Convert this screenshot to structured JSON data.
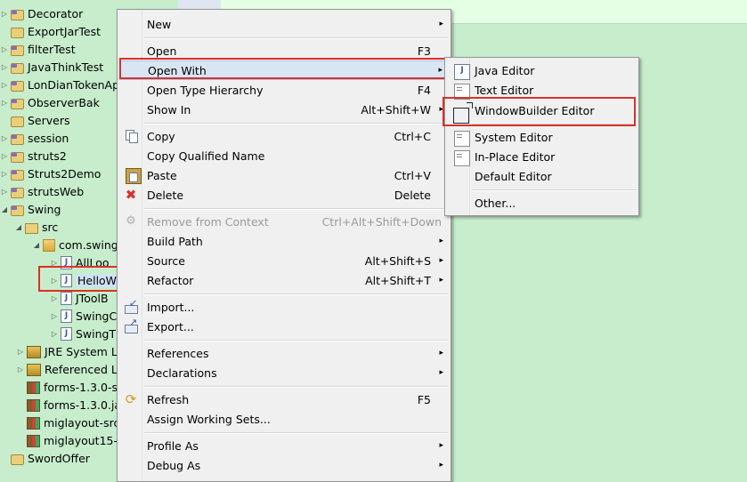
{
  "tree": {
    "items": [
      {
        "label": "Decorator",
        "type": "project"
      },
      {
        "label": "ExportJarTest",
        "type": "folder"
      },
      {
        "label": "filterTest",
        "type": "project"
      },
      {
        "label": "JavaThinkTest",
        "type": "project"
      },
      {
        "label": "LonDianTokenAp",
        "type": "project"
      },
      {
        "label": "ObserverBak",
        "type": "project"
      },
      {
        "label": "Servers",
        "type": "folder"
      },
      {
        "label": "session",
        "type": "project"
      },
      {
        "label": "struts2",
        "type": "project"
      },
      {
        "label": "Struts2Demo",
        "type": "project"
      },
      {
        "label": "strutsWeb",
        "type": "project"
      },
      {
        "label": "Swing",
        "type": "project"
      },
      {
        "label": "src",
        "type": "srcfolder"
      },
      {
        "label": "com.swing",
        "type": "package"
      },
      {
        "label": "AllLoo",
        "type": "java"
      },
      {
        "label": "HelloW",
        "type": "java"
      },
      {
        "label": "JToolB",
        "type": "java"
      },
      {
        "label": "SwingC",
        "type": "java"
      },
      {
        "label": "SwingT",
        "type": "java"
      },
      {
        "label": "JRE System Li",
        "type": "library"
      },
      {
        "label": "Referenced L",
        "type": "library"
      },
      {
        "label": "forms-1.3.0-s",
        "type": "jar"
      },
      {
        "label": "forms-1.3.0.ja",
        "type": "jar"
      },
      {
        "label": "miglayout-src",
        "type": "jar"
      },
      {
        "label": "miglayout15-",
        "type": "jar"
      },
      {
        "label": "SwordOffer",
        "type": "folder"
      }
    ]
  },
  "context_menu": {
    "items": [
      {
        "label": "New",
        "shortcut": "",
        "submenu": true
      },
      {
        "label": "Open",
        "shortcut": "F3"
      },
      {
        "label": "Open With",
        "shortcut": "",
        "submenu": true
      },
      {
        "label": "Open Type Hierarchy",
        "shortcut": "F4"
      },
      {
        "label": "Show In",
        "shortcut": "Alt+Shift+W",
        "submenu": true
      },
      {
        "label": "Copy",
        "shortcut": "Ctrl+C",
        "icon": "copy-icon"
      },
      {
        "label": "Copy Qualified Name",
        "shortcut": ""
      },
      {
        "label": "Paste",
        "shortcut": "Ctrl+V",
        "icon": "paste-icon"
      },
      {
        "label": "Delete",
        "shortcut": "Delete",
        "icon": "delete-icon"
      },
      {
        "label": "Remove from Context",
        "shortcut": "Ctrl+Alt+Shift+Down",
        "icon": "remove-context-icon",
        "disabled": true
      },
      {
        "label": "Build Path",
        "shortcut": "",
        "submenu": true
      },
      {
        "label": "Source",
        "shortcut": "Alt+Shift+S",
        "submenu": true
      },
      {
        "label": "Refactor",
        "shortcut": "Alt+Shift+T",
        "submenu": true
      },
      {
        "label": "Import...",
        "shortcut": "",
        "icon": "import-icon"
      },
      {
        "label": "Export...",
        "shortcut": "",
        "icon": "export-icon"
      },
      {
        "label": "References",
        "shortcut": "",
        "submenu": true
      },
      {
        "label": "Declarations",
        "shortcut": "",
        "submenu": true
      },
      {
        "label": "Refresh",
        "shortcut": "F5",
        "icon": "refresh-icon"
      },
      {
        "label": "Assign Working Sets...",
        "shortcut": ""
      },
      {
        "label": "Profile As",
        "shortcut": "",
        "submenu": true
      },
      {
        "label": "Debug As",
        "shortcut": "",
        "submenu": true
      }
    ],
    "submenu_arrow": "▸"
  },
  "open_with_submenu": {
    "items": [
      {
        "label": "Java Editor",
        "icon": "java-editor-icon"
      },
      {
        "label": "Text Editor",
        "icon": "text-editor-icon"
      },
      {
        "label": "WindowBuilder Editor",
        "icon": "windowbuilder-icon"
      },
      {
        "label": "System Editor",
        "icon": "system-editor-icon"
      },
      {
        "label": "In-Place Editor",
        "icon": "in-place-editor-icon"
      },
      {
        "label": "Default Editor",
        "icon": ""
      },
      {
        "label": "Other...",
        "icon": ""
      }
    ]
  },
  "colors": {
    "background": "#c7edcc",
    "menu_bg": "#f0f0f0",
    "highlight_box": "#d9312b"
  }
}
